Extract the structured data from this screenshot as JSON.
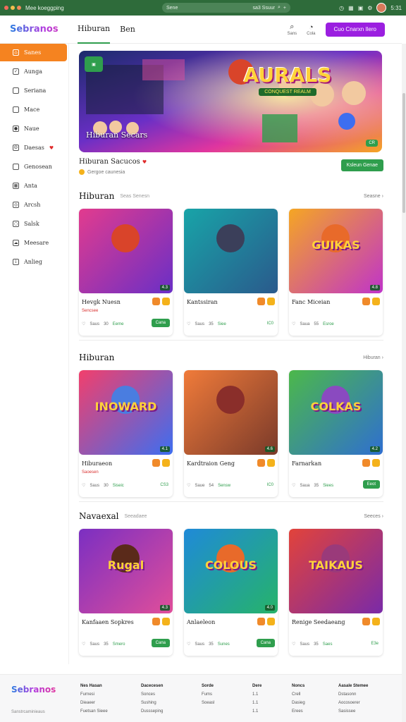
{
  "browser": {
    "title": "Mee koeggping",
    "url": "Sene",
    "url_right": "sa3 Ssuur",
    "time": "5:31"
  },
  "header": {
    "logo": "Sebranos",
    "tabs": [
      "Hiburan",
      "Ben"
    ],
    "search_label": "Sans",
    "notif_label": "Cola",
    "cta": "Cuo Cnarxn Ilero"
  },
  "sidebar": {
    "items": [
      {
        "label": "Sanes",
        "icon": "home-icon",
        "active": true
      },
      {
        "label": "Aunga",
        "icon": "check-icon"
      },
      {
        "label": "Seriana",
        "icon": "box-icon"
      },
      {
        "label": "Mace",
        "icon": "box-icon"
      },
      {
        "label": "Naue",
        "icon": "apple-icon"
      },
      {
        "label": "Daesas",
        "icon": "smile-icon",
        "heart": true
      },
      {
        "label": "Genosean",
        "icon": "box-icon"
      },
      {
        "label": "Anta",
        "icon": "grid-icon"
      },
      {
        "label": "Arcsh",
        "icon": "compass-icon"
      },
      {
        "label": "Salsk",
        "icon": "circle-icon"
      },
      {
        "label": "Meesare",
        "icon": "cloud-icon"
      },
      {
        "label": "Anlieg",
        "icon": "info-icon"
      }
    ]
  },
  "hero": {
    "title": "Hiburan Secars",
    "logo_text": "AURALS",
    "logo_sub": "CONQUEST REALM",
    "tag": "CR",
    "feature_title": "Hiburan Sacucos",
    "feature_sub": "Gergoe caunesia",
    "feature_button": "Ksleun Genae"
  },
  "sections": [
    {
      "title": "Hiburan",
      "subtitle": "Seas Senesn",
      "see_all": "Seasne",
      "cards": [
        {
          "name": "Hevgk Nuesn",
          "cat": "Sencsee",
          "meta1": "Saus",
          "meta2": "30",
          "meta3": "Eeme",
          "rating": "4.3",
          "action": "Cana",
          "kind": "button",
          "colors": [
            "#e23b8e",
            "#6a2fc6"
          ],
          "label": "",
          "mascot": "#d9442a"
        },
        {
          "name": "Kantssiran",
          "cat": "",
          "meta1": "Saus",
          "meta2": "35",
          "meta3": "Siee",
          "rating": "",
          "action": "IC0",
          "kind": "price",
          "colors": [
            "#18a4a8",
            "#2a5a8c"
          ],
          "label": "",
          "mascot": "#3b3f5a"
        },
        {
          "name": "Fanc Miceian",
          "cat": "",
          "meta1": "Saua",
          "meta2": "55",
          "meta3": "Esroe",
          "rating": "4.8",
          "action": "",
          "kind": "price",
          "colors": [
            "#f5a623",
            "#c034c9"
          ],
          "label": "GUIKAS",
          "mascot": "#e86a2a"
        }
      ]
    },
    {
      "title": "Hiburan",
      "subtitle": "",
      "see_all": "Hiburan",
      "cards": [
        {
          "name": "Hiburaeon",
          "cat": "Saoesen",
          "meta1": "Saus",
          "meta2": "30",
          "meta3": "Siseic",
          "rating": "4.1",
          "action": "CS3",
          "kind": "price",
          "colors": [
            "#f23f6c",
            "#3d6ef0"
          ],
          "label": "INOWARD",
          "mascot": "#4a7de0"
        },
        {
          "name": "Kardtraion Geng",
          "cat": "",
          "meta1": "Saue",
          "meta2": "54",
          "meta3": "Sensw",
          "rating": "4.6",
          "action": "IC0",
          "kind": "price",
          "colors": [
            "#f07b3a",
            "#7a3a2a"
          ],
          "label": "",
          "mascot": "#8a2e2a"
        },
        {
          "name": "Farnarkan",
          "cat": "",
          "meta1": "Saua",
          "meta2": "35",
          "meta3": "Siees",
          "rating": "4.2",
          "action": "Eeot",
          "kind": "button",
          "colors": [
            "#4cb84a",
            "#2f6fd0"
          ],
          "label": "COLKAS",
          "mascot": "#8a4ac0"
        }
      ]
    },
    {
      "title": "Navaexal",
      "subtitle": "Seeadaee",
      "see_all": "Seeces",
      "cards": [
        {
          "name": "Kanfaaen Sopkres",
          "cat": "",
          "meta1": "Saus",
          "meta2": "35",
          "meta3": "Smero",
          "rating": "4.3",
          "action": "Cana",
          "kind": "button",
          "colors": [
            "#7b2fc2",
            "#e04e9a"
          ],
          "label": "Rugal",
          "mascot": "#5a2a1a"
        },
        {
          "name": "Anlaeleon",
          "cat": "",
          "meta1": "Saus",
          "meta2": "35",
          "meta3": "Sunes",
          "rating": "4.0",
          "action": "Cana",
          "kind": "button",
          "colors": [
            "#1f8ad8",
            "#26b36a"
          ],
          "label": "COLOUS",
          "mascot": "#e86a2a"
        },
        {
          "name": "Renige Seedaeang",
          "cat": "",
          "meta1": "Saus",
          "meta2": "35",
          "meta3": "Saes",
          "rating": "",
          "action": "E3e",
          "kind": "price",
          "colors": [
            "#e2433a",
            "#7a2aa8"
          ],
          "label": "TAIKAUS",
          "mascot": "#9a3a7a"
        }
      ]
    }
  ],
  "footer": {
    "logo": "Sebranos",
    "copyright": "Sanstrcaminieaus",
    "columns": [
      {
        "head": "Nes Hasan",
        "items": [
          "Furnesi",
          "Dieaeer",
          "Fuetsan Sieee"
        ]
      },
      {
        "head": "Dacecesen",
        "items": [
          "Sonces",
          "Sushing",
          "Dussseping"
        ]
      },
      {
        "head": "Sorde",
        "items": [
          "Fums",
          "Soeasl",
          ""
        ]
      },
      {
        "head": "Dere",
        "items": [
          "1.1",
          "1.1",
          "1.1"
        ]
      },
      {
        "head": "Noncs",
        "items": [
          "Crell",
          "Dasieg",
          "Erees"
        ]
      },
      {
        "head": "Aasale Stemee",
        "items": [
          "Dstasonn",
          "Aocosoerer",
          "Sasissee"
        ]
      }
    ]
  }
}
